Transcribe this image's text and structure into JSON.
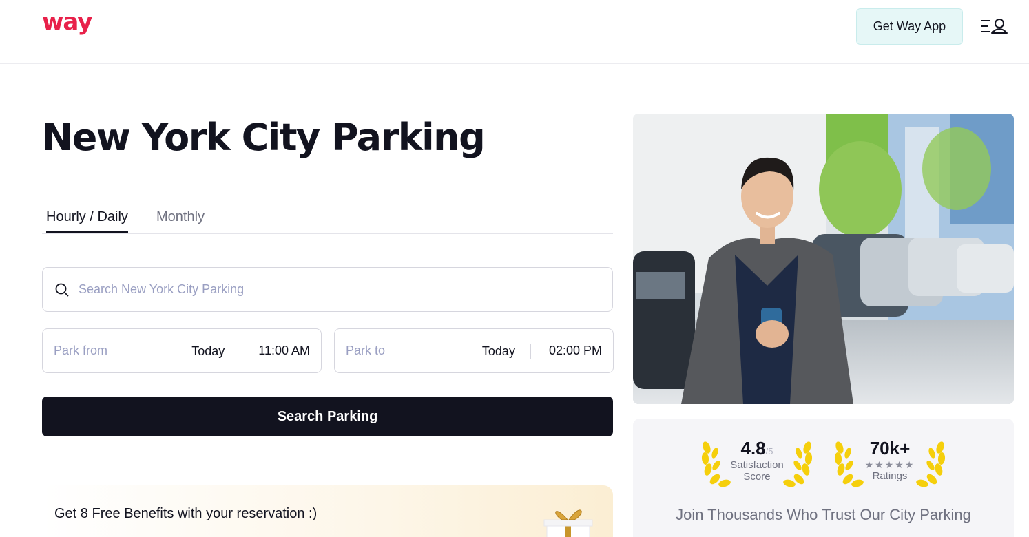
{
  "header": {
    "logo": "way",
    "get_app_label": "Get Way App",
    "menu_icon": "menu-user-icon"
  },
  "main": {
    "title": "New York City Parking",
    "tabs": [
      {
        "label": "Hourly / Daily",
        "active": true
      },
      {
        "label": "Monthly",
        "active": false
      }
    ],
    "search": {
      "placeholder": "Search New York City Parking",
      "value": "",
      "icon": "search-icon"
    },
    "park_from": {
      "label": "Park from",
      "day": "Today",
      "time": "11:00 AM"
    },
    "park_to": {
      "label": "Park to",
      "day": "Today",
      "time": "02:00 PM"
    },
    "search_button": "Search Parking",
    "benefits_text": "Get 8 Free Benefits with your reservation :)",
    "gift_icon": "gift-icon"
  },
  "stats": {
    "rating": {
      "value": "4.8",
      "suffix": "/5",
      "label_line1": "Satisfaction",
      "label_line2": "Score"
    },
    "ratings_count": {
      "value": "70k+",
      "stars": "★★★★★",
      "label": "Ratings"
    },
    "trust_text": "Join Thousands Who Trust Our City Parking"
  },
  "colors": {
    "brand": "#e8214a",
    "dark": "#12131f",
    "app_button_bg": "#e6f7f7",
    "placeholder": "#9a9fc2",
    "laurel": "#f5cf0c"
  }
}
